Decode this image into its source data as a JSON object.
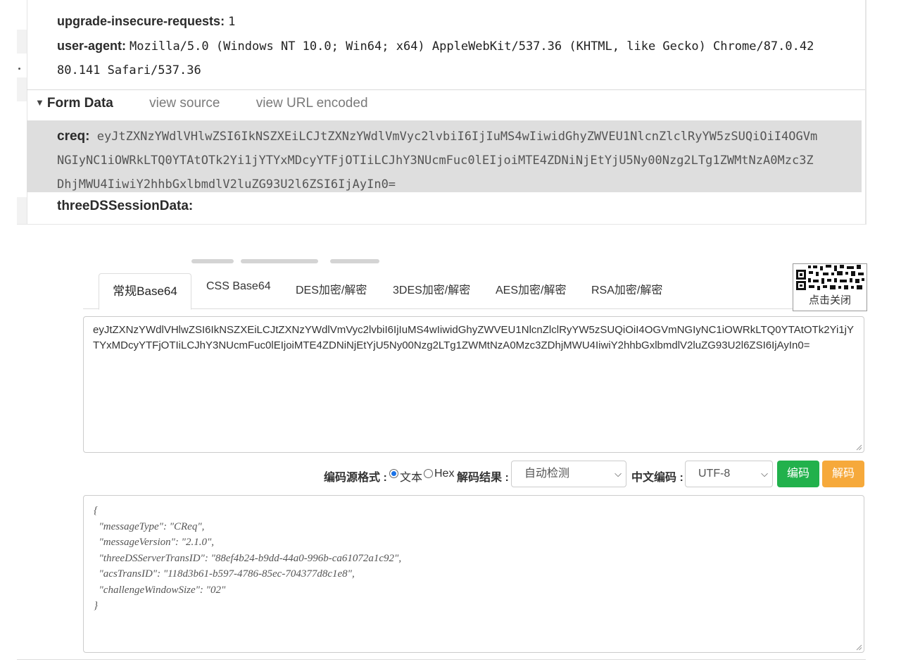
{
  "devtools": {
    "headers": [
      {
        "key": "upgrade-insecure-requests:",
        "value": "1"
      },
      {
        "key": "user-agent:",
        "value": "Mozilla/5.0 (Windows NT 10.0; Win64; x64) AppleWebKit/537.36 (KHTML, like Gecko) Chrome/87.0.42"
      },
      {
        "key": "",
        "value": "80.141 Safari/537.36"
      }
    ],
    "form_data": {
      "title": "Form Data",
      "view_source": "view source",
      "view_url_encoded": "view URL encoded",
      "creq_key": "creq:",
      "creq_lines": [
        "eyJtZXNzYWdlVHlwZSI6IkNSZXEiLCJtZXNzYWdlVmVyc2lvbiI6IjIuMS4wIiwidGhyZWVEU1NlcnZlclRyYW5zSUQiOiI4OGVm",
        "NGIyNC1iOWRkLTQ0YTAtOTk2Yi1jYTYxMDcyYTFjOTIiLCJhY3NUcmFuc0lEIjoiMTE4ZDNiNjEtYjU5Ny00Nzg2LTg1ZWMtNzA0Mzc3Z",
        "DhjMWU4IiwiY2hhbGxlbmdlV2luZG93U2l6ZSI6IjAyIn0="
      ],
      "three_ds_key": "threeDSSessionData:"
    }
  },
  "tool": {
    "qr_close": "点击关闭",
    "tabs": [
      {
        "label": "常规Base64"
      },
      {
        "label": "CSS Base64"
      },
      {
        "label": "DES加密/解密"
      },
      {
        "label": "3DES加密/解密"
      },
      {
        "label": "AES加密/解密"
      },
      {
        "label": "RSA加密/解密"
      }
    ],
    "input_value": "eyJtZXNzYWdlVHlwZSI6IkNSZXEiLCJtZXNzYWdlVmVyc2lvbiI6IjIuMS4wIiwidGhyZWVEU1NlcnZlclRyYW5zSUQiOiI4OGVmNGIyNC1iOWRkLTQ0YTAtOTk2Yi1jYTYxMDcyYTFjOTIiLCJhY3NUcmFuc0lEIjoiMTE4ZDNiNjEtYjU5Ny00Nzg2LTg1ZWMtNzA0Mzc3ZDhjMWU4IiwiY2hhbGxlbmdlV2luZG93U2l6ZSI6IjAyIn0=",
    "controls": {
      "source_format_label": "编码源格式 :",
      "radio_text": "文本",
      "radio_hex": "Hex",
      "decode_result_label": "解码结果 :",
      "decode_result_value": "自动检测",
      "chinese_encoding_label": "中文编码 :",
      "chinese_encoding_value": "UTF-8",
      "encode_button": "编码",
      "decode_button": "解码"
    },
    "output_value": "{\n  \"messageType\": \"CReq\",\n  \"messageVersion\": \"2.1.0\",\n  \"threeDSServerTransID\": \"88ef4b24-b9dd-44a0-996b-ca61072a1c92\",\n  \"acsTransID\": \"118d3b61-b597-4786-85ec-704377d8c1e8\",\n  \"challengeWindowSize\": \"02\"\n}",
    "colors": {
      "encode_button": "#22b14c",
      "decode_button": "#f6a93b",
      "creq_highlight": "#dedede"
    }
  }
}
